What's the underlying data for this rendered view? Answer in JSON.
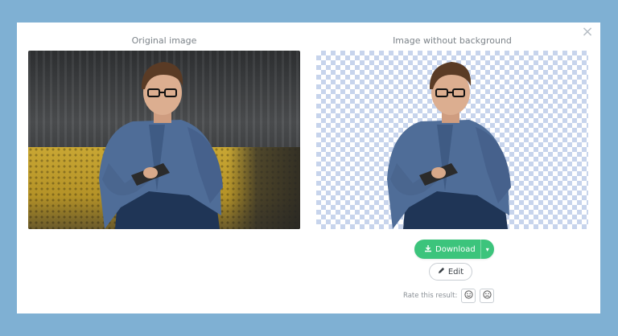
{
  "modal": {
    "close_label": "×",
    "left_title": "Original image",
    "right_title": "Image without background"
  },
  "actions": {
    "download_label": "Download",
    "download_icon": "download-icon",
    "dropdown_caret": "▾",
    "edit_label": "Edit",
    "edit_icon": "pencil-icon",
    "rate_label": "Rate this result:",
    "rate_good_icon": "smile-icon",
    "rate_bad_icon": "frown-icon"
  },
  "colors": {
    "backdrop": "#7fb0d3",
    "download_green": "#3cc47c",
    "checker": "#c7d4ec"
  }
}
